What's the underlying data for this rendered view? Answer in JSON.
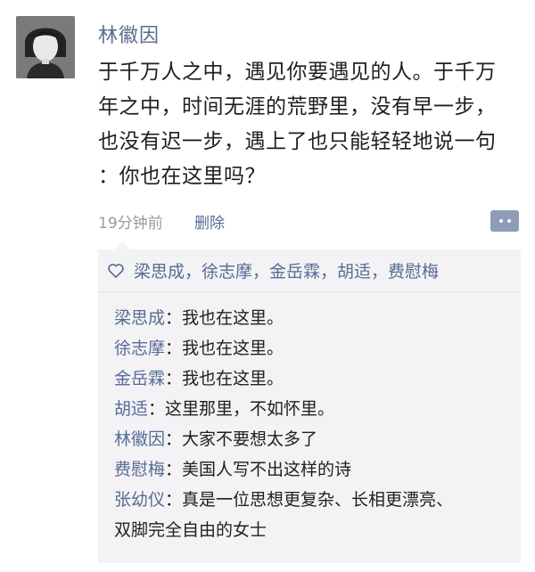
{
  "author": {
    "name": "林徽因",
    "avatar_icon": "portrait-photo"
  },
  "post": {
    "lines": [
      "于千万人之中，遇见你要遇见的人。于千万",
      "年之中，时间无涯的荒野里，没有早一步，",
      "也没有迟一步，遇上了也只能轻轻地说一句",
      "：你也在这里吗？"
    ]
  },
  "meta": {
    "time": "19分钟前",
    "delete_label": "删除"
  },
  "likes": {
    "icon": "heart-outline-icon",
    "names": "梁思成，徐志摩，金岳霖，胡适，费慰梅"
  },
  "comments": [
    {
      "author": "梁思成",
      "sep": "：",
      "text": "我也在这里。"
    },
    {
      "author": "徐志摩",
      "sep": "：",
      "text": "我也在这里。"
    },
    {
      "author": "金岳霖",
      "sep": "：",
      "text": "我也在这里。"
    },
    {
      "author": "胡适",
      "sep": "：",
      "text": "这里那里，不如怀里。"
    },
    {
      "author": "林徽因",
      "sep": "：",
      "text": "大家不要想太多了"
    },
    {
      "author": "费慰梅",
      "sep": "：",
      "text": "美国人写不出这样的诗"
    },
    {
      "author": "张幼仪",
      "sep": "：",
      "text": "真是一位思想更复杂、长相更漂亮、"
    }
  ],
  "comment_continuation": "双脚完全自由的女士",
  "colors": {
    "link": "#576b95",
    "panel_bg": "#f3f3f5",
    "meta": "#9a9a9a",
    "comment_button": "#8e9cb8"
  }
}
